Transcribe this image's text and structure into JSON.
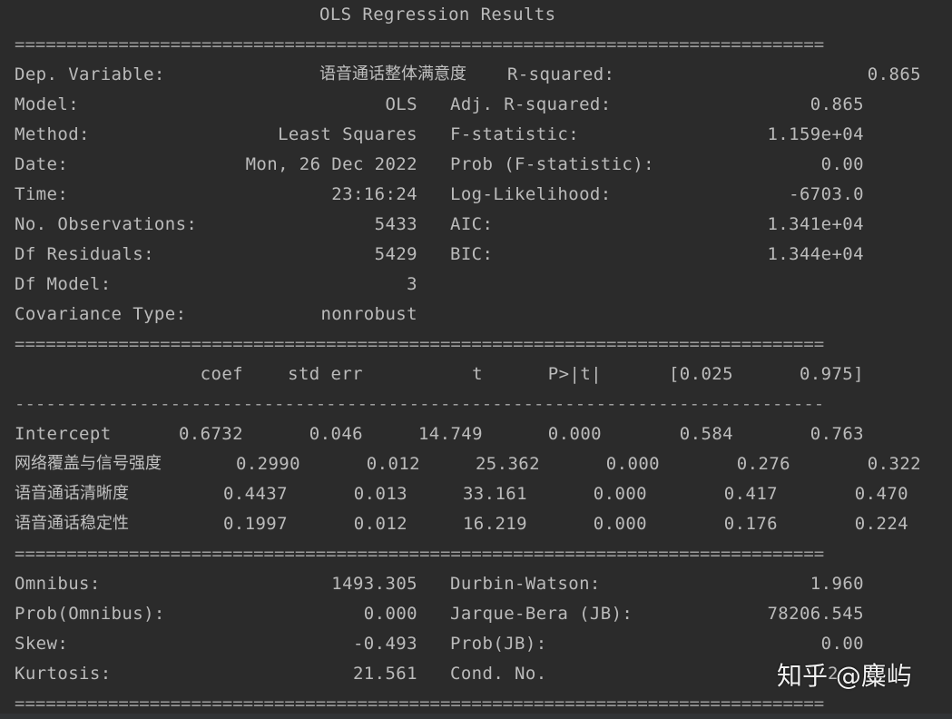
{
  "title": "OLS Regression Results",
  "rules": {
    "double": "==============================================================================",
    "dash": "------------------------------------------------------------------------------"
  },
  "summary": [
    {
      "llabel": "Dep. Variable:",
      "lvalue": "语音通话整体满意度",
      "rlabel": "R-squared:",
      "rvalue": "0.865"
    },
    {
      "llabel": "Model:",
      "lvalue": "OLS",
      "rlabel": "Adj. R-squared:",
      "rvalue": "0.865"
    },
    {
      "llabel": "Method:",
      "lvalue": "Least Squares",
      "rlabel": "F-statistic:",
      "rvalue": "1.159e+04"
    },
    {
      "llabel": "Date:",
      "lvalue": "Mon, 26 Dec 2022",
      "rlabel": "Prob (F-statistic):",
      "rvalue": "0.00"
    },
    {
      "llabel": "Time:",
      "lvalue": "23:16:24",
      "rlabel": "Log-Likelihood:",
      "rvalue": "-6703.0"
    },
    {
      "llabel": "No. Observations:",
      "lvalue": "5433",
      "rlabel": "AIC:",
      "rvalue": "1.341e+04"
    },
    {
      "llabel": "Df Residuals:",
      "lvalue": "5429",
      "rlabel": "BIC:",
      "rvalue": "1.344e+04"
    },
    {
      "llabel": "Df Model:",
      "lvalue": "3",
      "rlabel": "",
      "rvalue": ""
    },
    {
      "llabel": "Covariance Type:",
      "lvalue": "nonrobust",
      "rlabel": "",
      "rvalue": ""
    }
  ],
  "coef_headers": [
    "coef",
    "std err",
    "t",
    "P>|t|",
    "[0.025",
    "0.975]"
  ],
  "coef_rows": [
    {
      "name": "Intercept",
      "values": [
        "0.6732",
        "0.046",
        "14.749",
        "0.000",
        "0.584",
        "0.763"
      ]
    },
    {
      "name": "网络覆盖与信号强度",
      "values": [
        "0.2990",
        "0.012",
        "25.362",
        "0.000",
        "0.276",
        "0.322"
      ]
    },
    {
      "name": "语音通话清晰度",
      "values": [
        "0.4437",
        "0.013",
        "33.161",
        "0.000",
        "0.417",
        "0.470"
      ]
    },
    {
      "name": "语音通话稳定性",
      "values": [
        "0.1997",
        "0.012",
        "16.219",
        "0.000",
        "0.176",
        "0.224"
      ]
    }
  ],
  "diagnostics": [
    {
      "llabel": "Omnibus:",
      "lvalue": "1493.305",
      "rlabel": "Durbin-Watson:",
      "rvalue": "1.960"
    },
    {
      "llabel": "Prob(Omnibus):",
      "lvalue": "0.000",
      "rlabel": "Jarque-Bera (JB):",
      "rvalue": "78206.545"
    },
    {
      "llabel": "Skew:",
      "lvalue": "-0.493",
      "rlabel": "Prob(JB):",
      "rvalue": "0.00"
    },
    {
      "llabel": "Kurtosis:",
      "lvalue": "21.561",
      "rlabel": "Cond. No.",
      "rvalue": "2"
    }
  ],
  "watermark": "知乎 @麋屿"
}
